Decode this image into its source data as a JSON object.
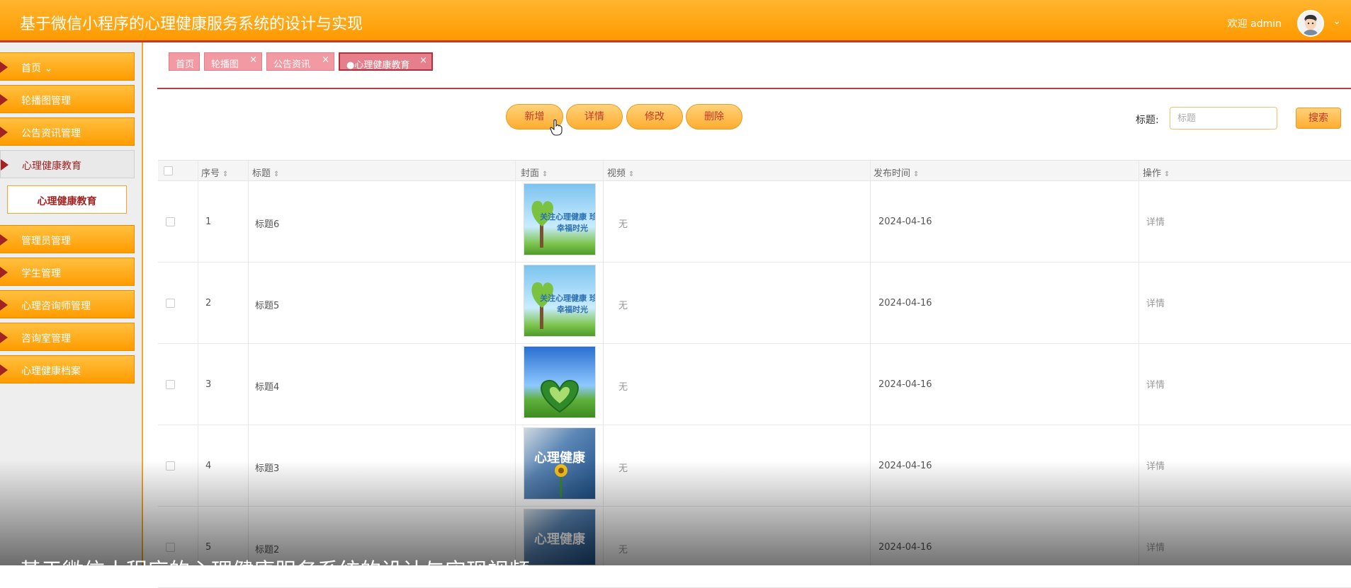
{
  "header": {
    "title": "基于微信小程序的心理健康服务系统的设计与实现",
    "welcome": "欢迎 admin",
    "chevron": "⌄"
  },
  "sidebar": {
    "items": [
      {
        "label": "首页 ⌄"
      },
      {
        "label": "轮播图管理"
      },
      {
        "label": "公告资讯管理"
      },
      {
        "label": "心理健康教育"
      },
      {
        "label": "管理员管理"
      },
      {
        "label": "学生管理"
      },
      {
        "label": "心理咨询师管理"
      },
      {
        "label": "咨询室管理"
      },
      {
        "label": "心理健康档案"
      }
    ],
    "submenu": {
      "label": "心理健康教育"
    }
  },
  "tabs": [
    {
      "label": "首页"
    },
    {
      "label": "轮播图"
    },
    {
      "label": "公告资讯"
    },
    {
      "label": "●心理健康教育"
    }
  ],
  "tab_close": "×",
  "toolbar": {
    "add": "新增",
    "detail": "详情",
    "edit": "修改",
    "delete": "删除"
  },
  "search": {
    "label": "标题:",
    "placeholder": "标题",
    "button": "搜索"
  },
  "table": {
    "columns": [
      "序号",
      "标题",
      "封面",
      "视频",
      "发布时间",
      "操作"
    ],
    "sort_glyph": "⇕",
    "rows": [
      {
        "no": "1",
        "title": "标题6",
        "cover": "关注心理健康 珍惜幸福时光",
        "video": "无",
        "date": "2024-04-16",
        "action": "详情"
      },
      {
        "no": "2",
        "title": "标题5",
        "cover": "关注心理健康 珍惜幸福时光",
        "video": "无",
        "date": "2024-04-16",
        "action": "详情"
      },
      {
        "no": "3",
        "title": "标题4",
        "cover": "",
        "video": "无",
        "date": "2024-04-16",
        "action": "详情"
      },
      {
        "no": "4",
        "title": "标题3",
        "cover": "心理健康",
        "video": "无",
        "date": "2024-04-16",
        "action": "详情"
      },
      {
        "no": "5",
        "title": "标题2",
        "cover": "心理健康",
        "video": "无",
        "date": "2024-04-16",
        "action": "详情"
      }
    ]
  },
  "subtitle": "基于微信小程序的心理健康服务系统的设计与实现视频",
  "colors": {
    "accent": "#ff9c00",
    "brand_red": "#c0392b",
    "tab_pink": "#f29aa3"
  }
}
